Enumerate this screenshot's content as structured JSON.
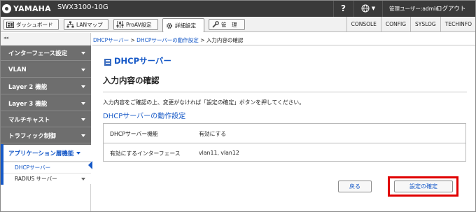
{
  "header": {
    "brand": "YAMAHA",
    "model": "SWX3100-10G",
    "help": "?",
    "user": "管理ユーザー:admin",
    "logout": "ログアウト"
  },
  "toolbar": {
    "tabs": [
      {
        "label": "ダッシュボード",
        "icon": "dashboard-icon"
      },
      {
        "label": "LANマップ",
        "icon": "lan-map-icon"
      },
      {
        "label": "ProAV設定",
        "icon": "proav-icon"
      },
      {
        "label": "詳細設定",
        "icon": "gear-icon",
        "active": true
      },
      {
        "label": "管　理",
        "icon": "wrench-icon"
      }
    ],
    "links": [
      "CONSOLE",
      "CONFIG",
      "SYSLOG",
      "TECHINFO"
    ]
  },
  "sidebar": {
    "collapse": "◂◂",
    "items": [
      {
        "label": "インターフェース設定"
      },
      {
        "label": "VLAN"
      },
      {
        "label": "Layer 2 機能"
      },
      {
        "label": "Layer 3 機能"
      },
      {
        "label": "マルチキャスト"
      },
      {
        "label": "トラフィック制御"
      },
      {
        "label": "アプリケーション層機能",
        "open": true
      }
    ],
    "subitems": [
      {
        "label": "DHCPサーバー",
        "current": true
      },
      {
        "label": "RADIUS サーバー"
      }
    ]
  },
  "breadcrumb": {
    "crumb1": "DHCPサーバー",
    "sep1": " > ",
    "crumb2": "DHCPサーバーの動作設定",
    "sep2": " > ",
    "current": "入力内容の確認"
  },
  "main": {
    "title": "DHCPサーバー",
    "subtitle": "入力内容の確認",
    "instruction": "入力内容をご確認の上、変更がなければ「設定の確定」ボタンを押してください。",
    "section": "DHCPサーバーの動作設定",
    "rows": [
      {
        "label": "DHCPサーバー機能",
        "value": "有効にする"
      },
      {
        "label": "有効にするインターフェース",
        "value": "vlan11, vlan12"
      }
    ],
    "back_label": "戻る",
    "confirm_label": "設定の確定"
  },
  "colors": {
    "header_bg": "#3a3a3a",
    "sidebar_bg": "#6e6e6e",
    "accent": "#1558c7",
    "highlight": "#e00000"
  }
}
